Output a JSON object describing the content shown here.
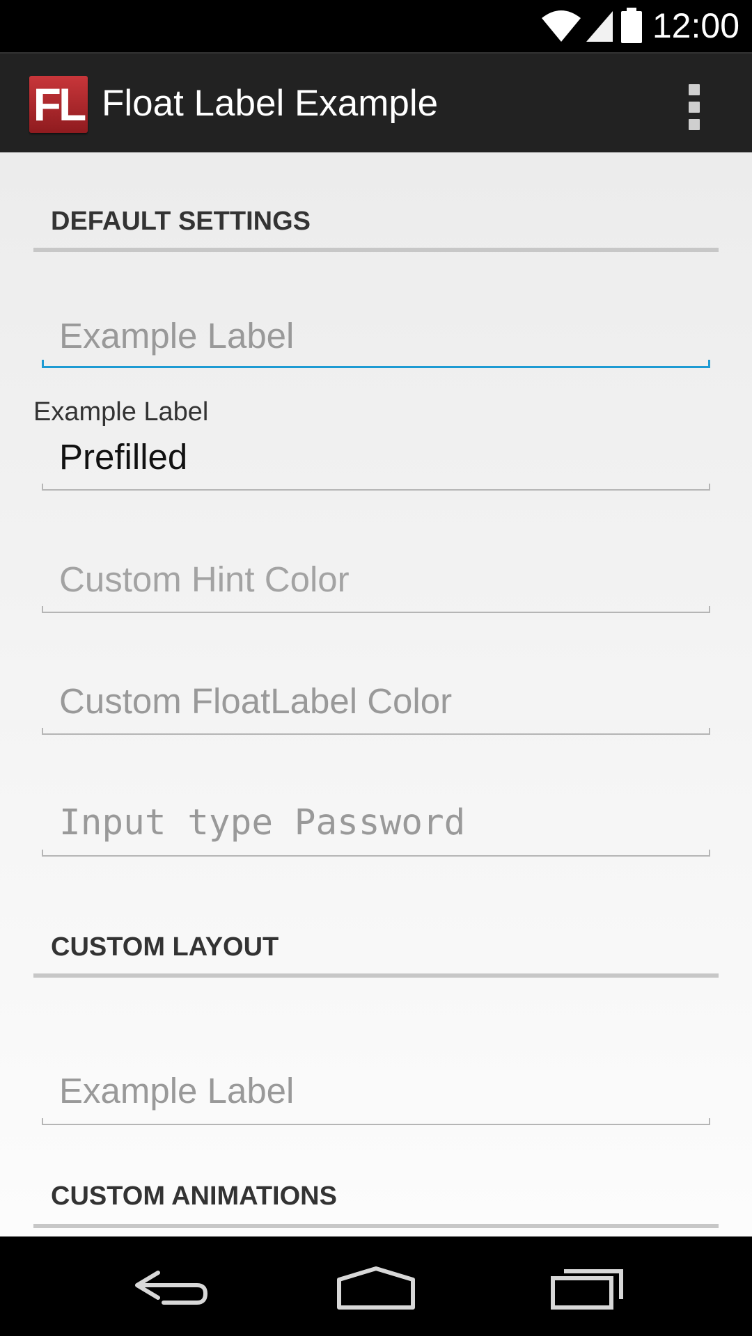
{
  "status_bar": {
    "time": "12:00"
  },
  "action_bar": {
    "logo_text": "FL",
    "title": "Float Label Example",
    "overflow_icon": "overflow-menu-icon"
  },
  "sections": {
    "default": {
      "title": "DEFAULT SETTINGS"
    },
    "custom_layout": {
      "title": "CUSTOM LAYOUT"
    },
    "custom_animations": {
      "title": "CUSTOM ANIMATIONS"
    }
  },
  "fields": {
    "example_label": {
      "hint": "Example Label"
    },
    "prefilled": {
      "float_label": "Example Label",
      "value": "Prefilled"
    },
    "custom_hint_color": {
      "hint": "Custom Hint Color"
    },
    "custom_floatlabel_color": {
      "hint": "Custom FloatLabel Color"
    },
    "password": {
      "hint": "Input type Password"
    },
    "custom_layout_example": {
      "hint": "Example Label"
    }
  },
  "colors": {
    "accent": "#1e9bd3",
    "action_bar": "#222222",
    "logo": "#b3272b"
  },
  "nav_bar": {
    "back_icon": "back-icon",
    "home_icon": "home-icon",
    "recents_icon": "recents-icon"
  }
}
